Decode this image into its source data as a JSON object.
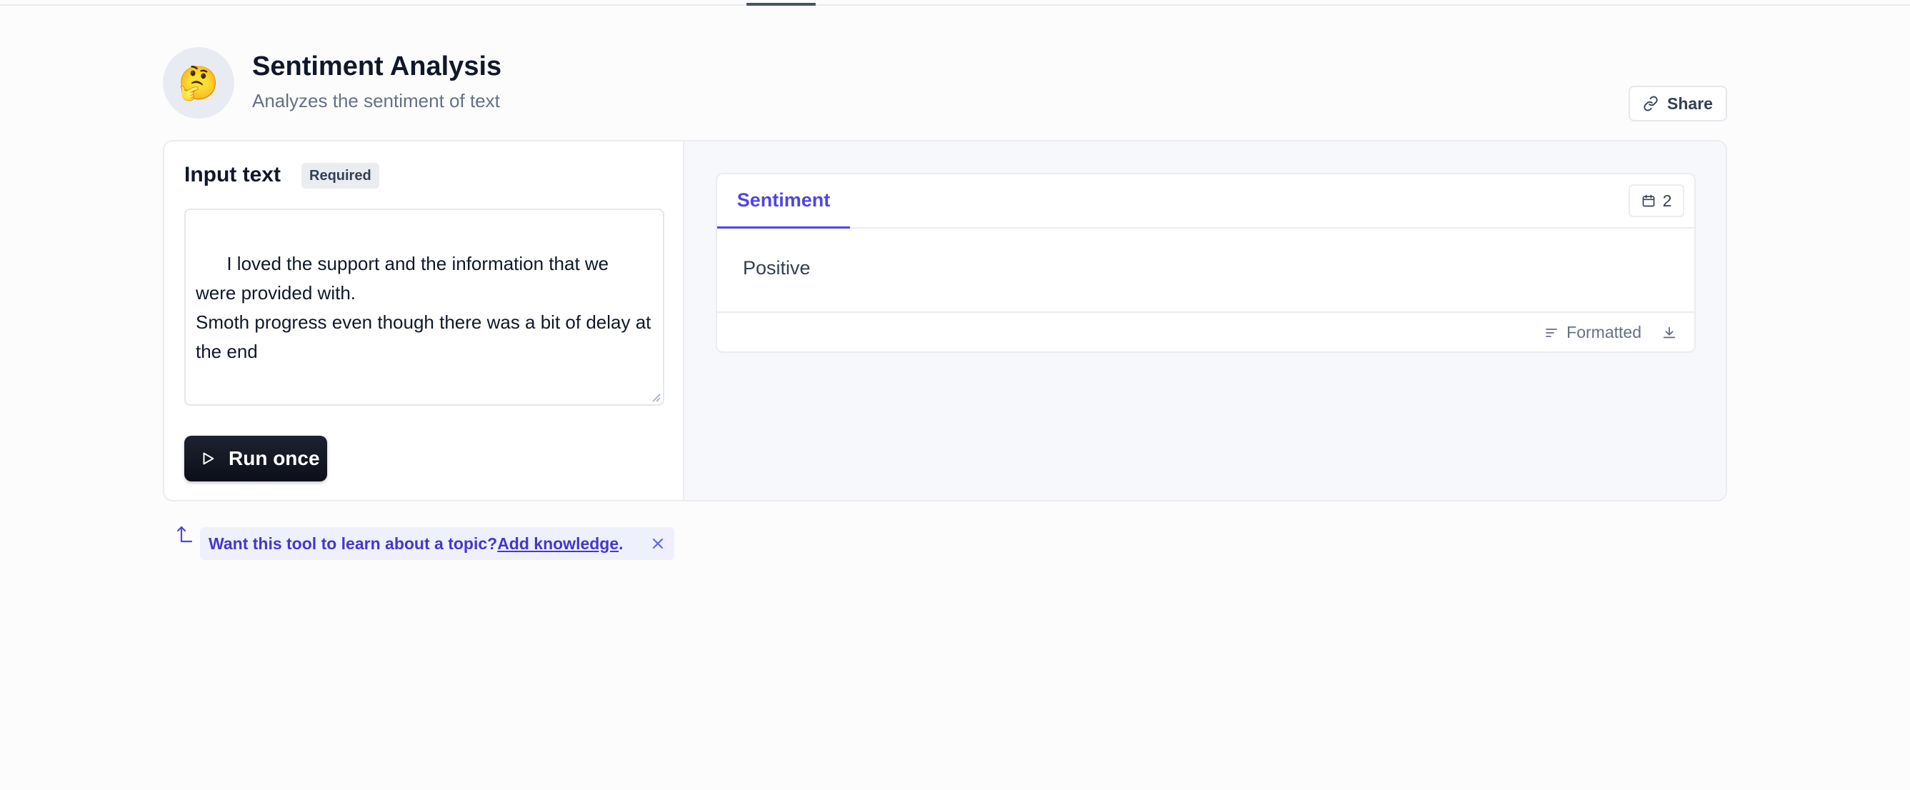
{
  "app": {
    "title": "Sentiment Analysis",
    "subtitle": "Analyzes the sentiment of text",
    "avatar_emoji": "🤔",
    "share_label": "Share"
  },
  "input": {
    "label": "Input text",
    "badge": "Required",
    "value": "I loved the support and the information that we were provided with.\nSmoth progress even though there was a bit of delay at the end",
    "run_label": "Run once"
  },
  "output": {
    "tab_label": "Sentiment",
    "count": "2",
    "result": "Positive",
    "format_label": "Formatted"
  },
  "hint": {
    "prefix": "Want this tool to learn about a topic? ",
    "link": "Add knowledge",
    "suffix": "."
  },
  "colors": {
    "accent": "#4f46e5",
    "button_dark": "#0c0f1a",
    "hint_bg": "#eef0fe"
  },
  "icons": {
    "share": "link-icon",
    "run": "play-icon",
    "count": "calendar-icon",
    "format": "lines-icon",
    "download": "download-icon",
    "close": "close-icon",
    "arrow": "arrow-up-icon"
  }
}
